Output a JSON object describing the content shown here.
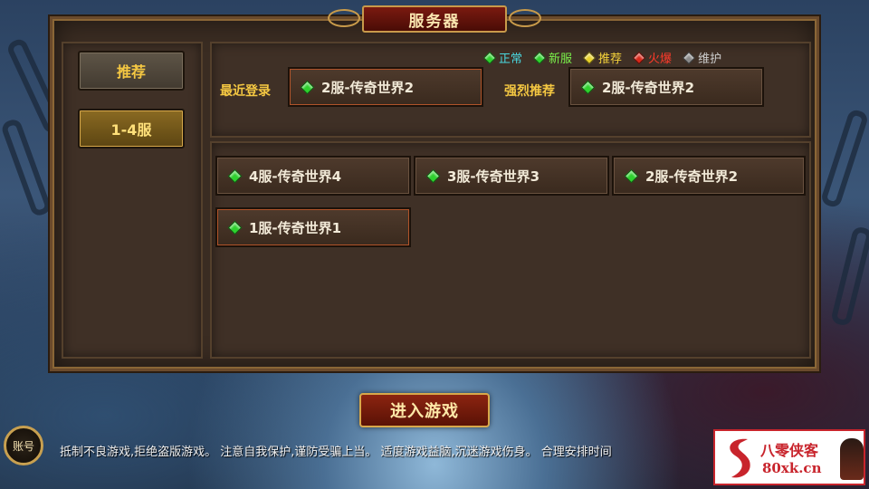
{
  "window": {
    "title": "服务器"
  },
  "sidebar": {
    "tabs": [
      {
        "label": "推荐",
        "selected": false
      },
      {
        "label": "1-4服",
        "selected": true
      }
    ]
  },
  "legend": [
    {
      "label": "正常",
      "color": "#4ad8e0",
      "gem_color": "#2ed12e"
    },
    {
      "label": "新服",
      "color": "#7af04a",
      "gem_color": "#2ed12e"
    },
    {
      "label": "推荐",
      "color": "#f5d23a",
      "gem_color": "#e8d02a"
    },
    {
      "label": "火爆",
      "color": "#ff3a2a",
      "gem_color": "#d8281a"
    },
    {
      "label": "维护",
      "color": "#cfcfcf",
      "gem_color": "#8a8a8a"
    }
  ],
  "recent": {
    "label": "最近登录",
    "server": "2服-传奇世界2"
  },
  "recommended": {
    "label": "强烈推荐",
    "server": "2服-传奇世界2"
  },
  "servers": [
    {
      "name": "4服-传奇世界4",
      "status": "新服"
    },
    {
      "name": "3服-传奇世界3",
      "status": "新服"
    },
    {
      "name": "2服-传奇世界2",
      "status": "新服"
    },
    {
      "name": "1服-传奇世界1",
      "status": "新服"
    }
  ],
  "enter_button": "进入游戏",
  "account_button": "账号",
  "notice": "抵制不良游戏,拒绝盗版游戏。 注意自我保护,谨防受骗上当。 适度游戏益脑,沉迷游戏伤身。 合理安排时间",
  "watermark": {
    "name": "八零侠客",
    "domain": "80xk.cn"
  }
}
